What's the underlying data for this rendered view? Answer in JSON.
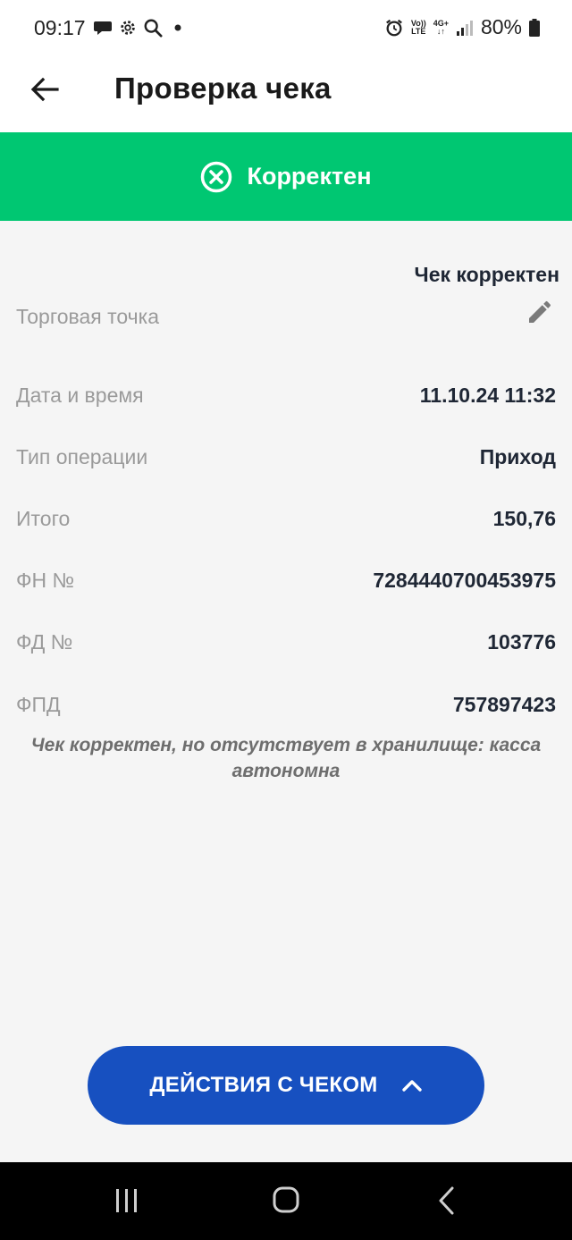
{
  "status_bar": {
    "time": "09:17",
    "left_icons": [
      "chat-icon",
      "gear-icon",
      "search-icon",
      "dot-icon"
    ],
    "volte_line1": "Vo))",
    "volte_line2": "LTE",
    "net_line1": "4G+",
    "net_line2": "↓↑",
    "battery": "80%"
  },
  "header": {
    "title": "Проверка чека",
    "back_icon": "arrow-left-icon"
  },
  "banner": {
    "text": "Корректен",
    "icon": "circle-x-icon",
    "color": "#00c772"
  },
  "summary": "Чек корректен",
  "rows": [
    {
      "label": "Торговая точка",
      "value": ""
    },
    {
      "label": "Дата и время",
      "value": "11.10.24 11:32"
    },
    {
      "label": "Тип операции",
      "value": "Приход"
    },
    {
      "label": "Итого",
      "value": "150,76"
    },
    {
      "label": "ФН №",
      "value": "7284440700453975"
    },
    {
      "label": "ФД №",
      "value": "103776"
    },
    {
      "label": "ФПД",
      "value": "757897423"
    }
  ],
  "note": "Чек корректен, но отсутствует в хранилище: касса автономна",
  "action_button": {
    "label": "ДЕЙСТВИЯ С ЧЕКОМ",
    "icon": "chevron-up-icon",
    "color": "#1750c0"
  },
  "nav": {
    "items": [
      "recent-apps-icon",
      "home-icon",
      "back-icon"
    ]
  }
}
